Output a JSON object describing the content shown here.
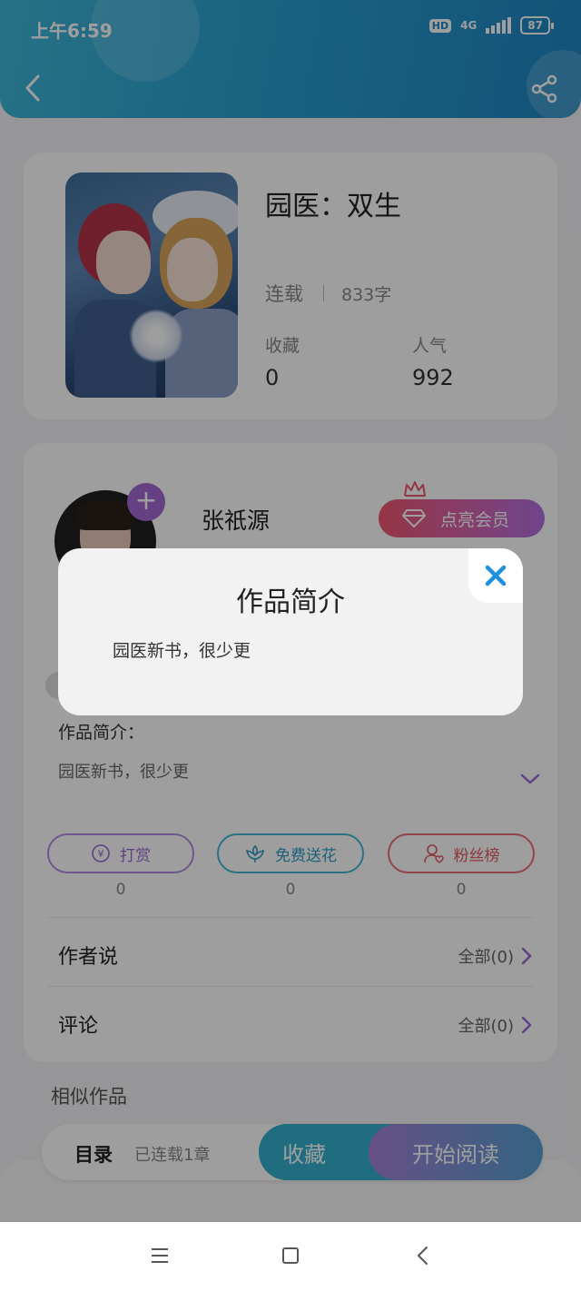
{
  "status_bar": {
    "time": "上午6:59",
    "hd": "HD",
    "network": "4G",
    "battery": "87"
  },
  "book": {
    "title": "园医：双生",
    "status": "连载",
    "words": "833字",
    "favorites_label": "收藏",
    "favorites_value": "0",
    "popularity_label": "人气",
    "popularity_value": "992"
  },
  "author": {
    "name": "张祇源",
    "follow_symbol": "+",
    "vip_label": "点亮会员"
  },
  "intro": {
    "label": "作品简介：",
    "text": "园医新书，很少更"
  },
  "actions": {
    "reward_label": "打赏",
    "reward_count": "0",
    "flower_label": "免费送花",
    "flower_count": "0",
    "fans_label": "粉丝榜",
    "fans_count": "0"
  },
  "rows": {
    "author_says": "作者说",
    "author_says_link": "全部(0)",
    "comments": "评论",
    "comments_link": "全部(0)"
  },
  "similar_title": "相似作品",
  "bottom": {
    "toc_label": "目录",
    "toc_sub": "已连载1章",
    "collect_label": "收藏",
    "read_label": "开始阅读"
  },
  "modal": {
    "title": "作品简介",
    "text": "园医新书，很少更"
  },
  "colors": {
    "header_start": "#3fb8d8",
    "header_end": "#1f86c4",
    "accent_purple": "#a46ad6",
    "accent_cyan": "#35b0cf",
    "accent_red": "#e35a61"
  }
}
